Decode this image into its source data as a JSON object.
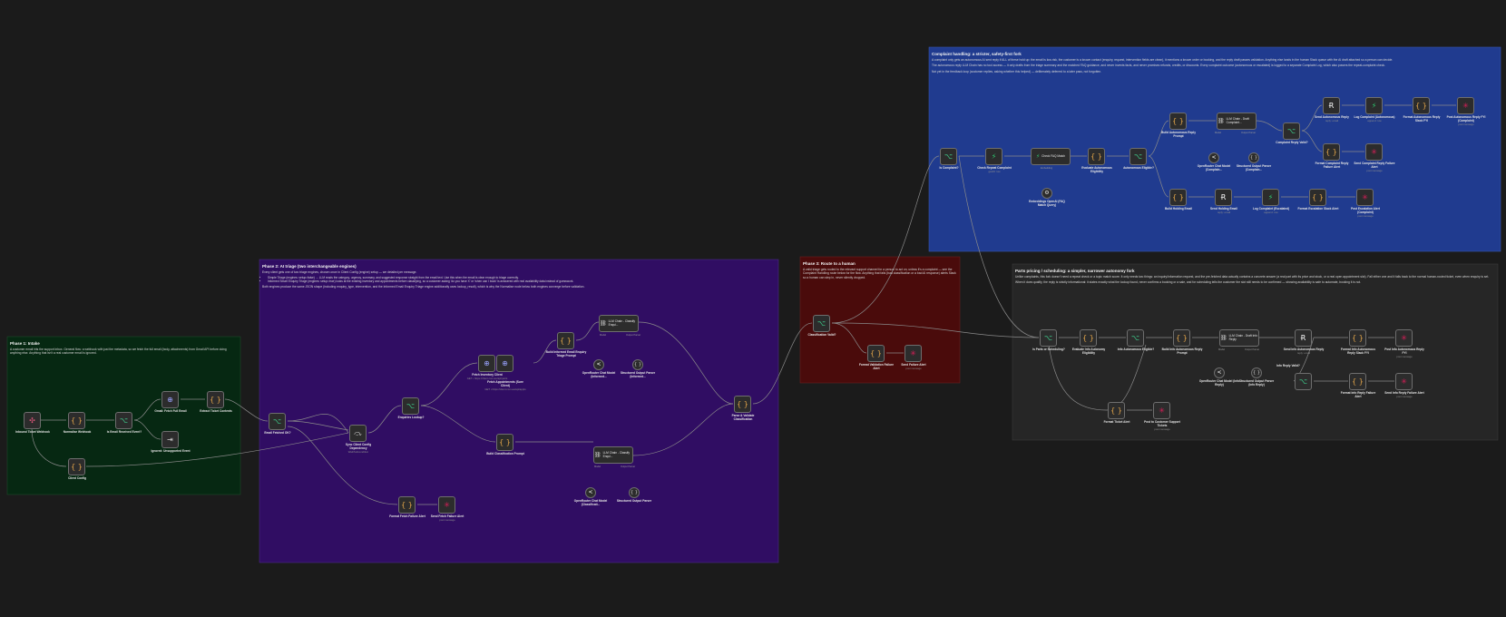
{
  "colors": {
    "canvas": "#1b1b1b",
    "phase1": "#062812",
    "phase2": "#300d63",
    "phase3": "#4a0b0b",
    "complaint": "#203b8f",
    "info": "#262626",
    "node_bg": "#2c2c2c",
    "edge": "#8a8a8a"
  },
  "notes": {
    "phase1": {
      "title": "Phase 1: Intake",
      "body": "A customer email hits the support inbox. General flow: a webhook with just the metadata, so we fetch the full email (body, attachments) from Gmail API before doing anything else. Anything that isn't a real customer email is ignored."
    },
    "phase2": {
      "title": "Phase 2: AI triage (two interchangeable engines)",
      "intro": "Every client gets one of two triage engines, chosen once in Client Config (engine) setup — we detailed per message.",
      "bullets": [
        "Simple Triage (engines: setup=false) → LLM reads the category, urgency, summary, and suggested response straight from the email text. Use this when the email is clear enough to triage correctly.",
        "Informed Smart Enquiry Triage (engines: setup=true) looks at the existing inventory and appointments before classifying, so a customer asking 'do you have X' or 'when can I book' is answered with real availability data instead of guesswork."
      ],
      "outro": "Both engines produce the same JSON shape (including enquiry_type, intervention, and the Informed Email Enquiry Triage engine additionally uses lookup_result), which is why the Normalise node below both engines converge before validation."
    },
    "phase3": {
      "title": "Phase 3: Route to a human",
      "body": "A valid triage gets routed to the relevant support channel for a person to act on, unless it's a complaint — see the Complaint Handling route below for the flow. Anything that fails (bad classification or a bad AI response) alerts Slack so a human can step in, never silently dropped."
    },
    "complaint": {
      "title": "Complaint handling: a stricter, safety-first fork",
      "p1": "A complaint only gets an autonomous AI sent reply if ALL of these hold up: the email is low-risk, the customer is a known contact (enquiry, request, intervention fields are clean), it mentions a known order or booking, and the reply draft passes validation. Anything else lands in the human Slack queue with the AI draft attached so a person can decide.",
      "p2": "The autonomous reply LLM Chain has no tool access — it only drafts from the triage summary and the matched FAQ guidance, and never invents facts, and never promises refunds, credits, or discounts. Every complaint outcome (autonomous or escalated) is logged to a separate Complaint Log, which also powers the repeat-complaint check.",
      "p3": "Not yet in the feedback loop (customer replies, asking whether this helped) — deliberately deferred to a later pass, not forgotten."
    },
    "info": {
      "title": "Parts pricing / scheduling: a simpler, narrower autonomy fork",
      "p1": "Unlike complaints, this fork doesn't need a repeat check or a topic match score. It only needs two things: an inquiry/information request, and the pre-fetched data actually contains a concrete answer (a real part with its price and stock, or a real open appointment slot). Fall either one and it falls back to the normal human-routed ticket, even when enquiry is set.",
      "p2": "When it does qualify, the reply is strictly informational: it states exactly what the lookup found, never confirms a booking or a sale, and for scheduling tells the customer the slot still needs to be confirmed — showing availability is safe to automate, booking it is not."
    }
  },
  "nodes": {
    "incoming_webhook": {
      "title": "Inbound Ticket Webhook",
      "sub": ""
    },
    "normalise_webhook": {
      "title": "Normalise Webhook",
      "sub": ""
    },
    "is_email_event": {
      "title": "Is Email Received Event?",
      "sub": ""
    },
    "gmail_fetch": {
      "title": "Gmail: Fetch Full Email",
      "sub": ""
    },
    "extract_ticket": {
      "title": "Extract Ticket Contents",
      "sub": ""
    },
    "ignored_event": {
      "title": "Ignored: Unsupported Event",
      "sub": ""
    },
    "client_config": {
      "title": "Client Config",
      "sub": ""
    },
    "email_fetched_ok": {
      "title": "Email Fetched OK?",
      "sub": ""
    },
    "sync_client_config": {
      "title": "Sync Client Config Dependency",
      "sub": "Wait/Subcondition"
    },
    "enquiries_lookup": {
      "title": "Enquiries Lookup?",
      "sub": ""
    },
    "fetch_inventory": {
      "title": "Fetch Inventory Client",
      "sub": "GET • https://client.com.au/api/parts"
    },
    "fetch_appointments": {
      "title": "Fetch Appointments (Sure Client)",
      "sub": "GET • https://client.com.au/api/appts"
    },
    "build_informed_prompt": {
      "title": "Build Informed Email Enquiry Triage Prompt",
      "sub": ""
    },
    "llm_informed": {
      "title": "LLM Chain - Classify Enqui...",
      "sub": ""
    },
    "openrouter_informed": {
      "title": "OpenRouter Chat Model (Informed...",
      "sub": ""
    },
    "parser_informed": {
      "title": "Structured Output Parser (Informed...",
      "sub": ""
    },
    "build_class_prompt": {
      "title": "Build Classification Prompt",
      "sub": ""
    },
    "llm_simple": {
      "title": "LLM Chain - Classify Enqui...",
      "sub": ""
    },
    "openrouter_simple": {
      "title": "OpenRouter Chat Model (Classificati...",
      "sub": ""
    },
    "parser_simple": {
      "title": "Structured Output Parser",
      "sub": ""
    },
    "format_fetch_fail": {
      "title": "Format Fetch Failure Alert",
      "sub": ""
    },
    "send_fetch_fail": {
      "title": "Send Fetch Failure Alert",
      "sub": "post message"
    },
    "parse_validate": {
      "title": "Parse & Validate Classification",
      "sub": ""
    },
    "classification_valid": {
      "title": "Classification Valid?",
      "sub": ""
    },
    "format_validation_fail": {
      "title": "Format Validation Failure Alert",
      "sub": ""
    },
    "send_failure_alert": {
      "title": "Send Failure Alert",
      "sub": "post message"
    },
    "is_complaint": {
      "title": "Is Complaint?",
      "sub": ""
    },
    "check_repeat": {
      "title": "Check Repeat Complaint",
      "sub": "getAll: row"
    },
    "check_faq": {
      "title": "Check FAQ Match",
      "sub": ""
    },
    "embeddings": {
      "title": "Embeddings OpenAI (FAQ Match Query)",
      "sub": ""
    },
    "eval_autonomous": {
      "title": "Evaluate Autonomous Eligibility",
      "sub": ""
    },
    "autonomous_eligible": {
      "title": "Autonomous Eligible?",
      "sub": ""
    },
    "build_auto_prompt": {
      "title": "Build Autonomous Reply Prompt",
      "sub": ""
    },
    "llm_complaint": {
      "title": "LLM Chain - Draft Complaint...",
      "sub": ""
    },
    "openrouter_complaint": {
      "title": "OpenRouter Chat Model (Complain...",
      "sub": ""
    },
    "parser_complaint": {
      "title": "Structured Output Parser (Complain...",
      "sub": ""
    },
    "complaint_reply_valid": {
      "title": "Complaint Reply Valid?",
      "sub": ""
    },
    "send_auto_reply": {
      "title": "Send Autonomous Reply",
      "sub": "reply: email"
    },
    "log_complaint_auto": {
      "title": "Log Complaint (Autonomous)",
      "sub": "append: row"
    },
    "format_auto_slack": {
      "title": "Format Autonomous Reply Slack FYI",
      "sub": ""
    },
    "post_auto_fyi": {
      "title": "Post Autonomous Reply FYI (Complaint)",
      "sub": "post message"
    },
    "format_complaint_fail": {
      "title": "Format Complaint Reply Failure Alert",
      "sub": ""
    },
    "send_complaint_fail": {
      "title": "Send Complaint Reply Failure Alert",
      "sub": "post message"
    },
    "send_holding": {
      "title": "Build Holding Email",
      "sub": ""
    },
    "send_holding_email": {
      "title": "Send Holding Email",
      "sub": "reply: email"
    },
    "log_escalated": {
      "title": "Log Complaint (Escalated)",
      "sub": "append: row"
    },
    "format_escalation": {
      "title": "Format Escalation Slack Alert",
      "sub": ""
    },
    "post_escalation": {
      "title": "Post Escalation Alert (Complaint)",
      "sub": "post message"
    },
    "is_parts": {
      "title": "Is Parts or Scheduling?",
      "sub": ""
    },
    "eval_info": {
      "title": "Evaluate Info Autonomy Eligibility",
      "sub": ""
    },
    "info_eligible": {
      "title": "Info Autonomous Eligible?",
      "sub": ""
    },
    "build_info_prompt": {
      "title": "Build Info Autonomous Reply Prompt",
      "sub": ""
    },
    "llm_info": {
      "title": "LLM Chain - Draft Info Reply",
      "sub": ""
    },
    "openrouter_info": {
      "title": "OpenRouter Chat Model (Info Reply)",
      "sub": ""
    },
    "parser_info": {
      "title": "Structured Output Parser (Info Reply)",
      "sub": ""
    },
    "info_reply_valid": {
      "title": "Info Reply Valid?",
      "sub": ""
    },
    "send_info_reply": {
      "title": "Send Info Autonomous Reply",
      "sub": "reply: email"
    },
    "format_info_fyi": {
      "title": "Format Info Autonomous Reply Slack FYI",
      "sub": ""
    },
    "post_info_fyi": {
      "title": "Post Info Autonomous Reply FYI",
      "sub": "post message"
    },
    "format_info_fail": {
      "title": "Format Info Reply Failure Alert",
      "sub": ""
    },
    "send_info_fail": {
      "title": "Send Info Reply Failure Alert",
      "sub": "post message"
    },
    "format_ticket": {
      "title": "Format Ticket Alert",
      "sub": ""
    },
    "post_support": {
      "title": "Post to Customer Support Tickets",
      "sub": "post message"
    }
  },
  "ports": {
    "model": "Model",
    "output_parser": "Output Parser",
    "embedding": "Embedding",
    "true": "true",
    "false": "false"
  }
}
